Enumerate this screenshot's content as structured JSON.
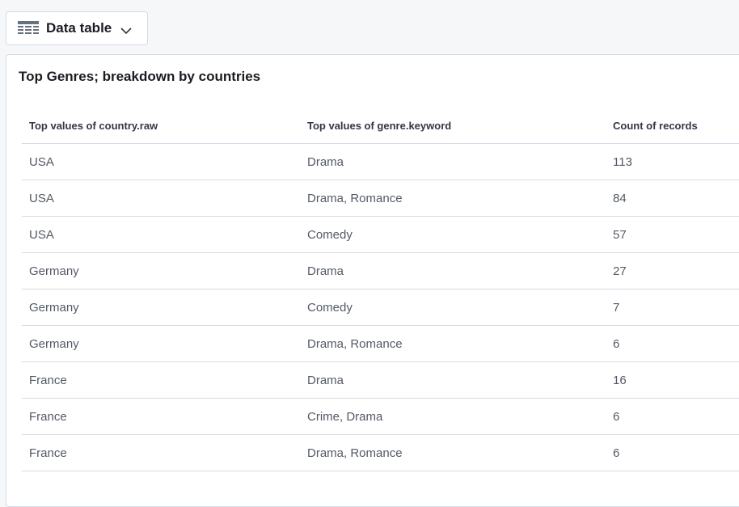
{
  "picker": {
    "label": "Data table",
    "icon": "table-icon",
    "dropdown_icon": "chevron-down-icon"
  },
  "panel": {
    "title": "Top Genres; breakdown by countries"
  },
  "table": {
    "columns": [
      "Top values of country.raw",
      "Top values of genre.keyword",
      "Count of records"
    ],
    "rows": [
      [
        "USA",
        "Drama",
        "113"
      ],
      [
        "USA",
        "Drama, Romance",
        "84"
      ],
      [
        "USA",
        "Comedy",
        "57"
      ],
      [
        "Germany",
        "Drama",
        "27"
      ],
      [
        "Germany",
        "Comedy",
        "7"
      ],
      [
        "Germany",
        "Drama, Romance",
        "6"
      ],
      [
        "France",
        "Drama",
        "16"
      ],
      [
        "France",
        "Crime, Drama",
        "6"
      ],
      [
        "France",
        "Drama, Romance",
        "6"
      ]
    ]
  },
  "colors": {
    "background": "#f6f7f9",
    "border": "#d3dae6",
    "title_text": "#1a1c21",
    "cell_text": "#535966"
  }
}
